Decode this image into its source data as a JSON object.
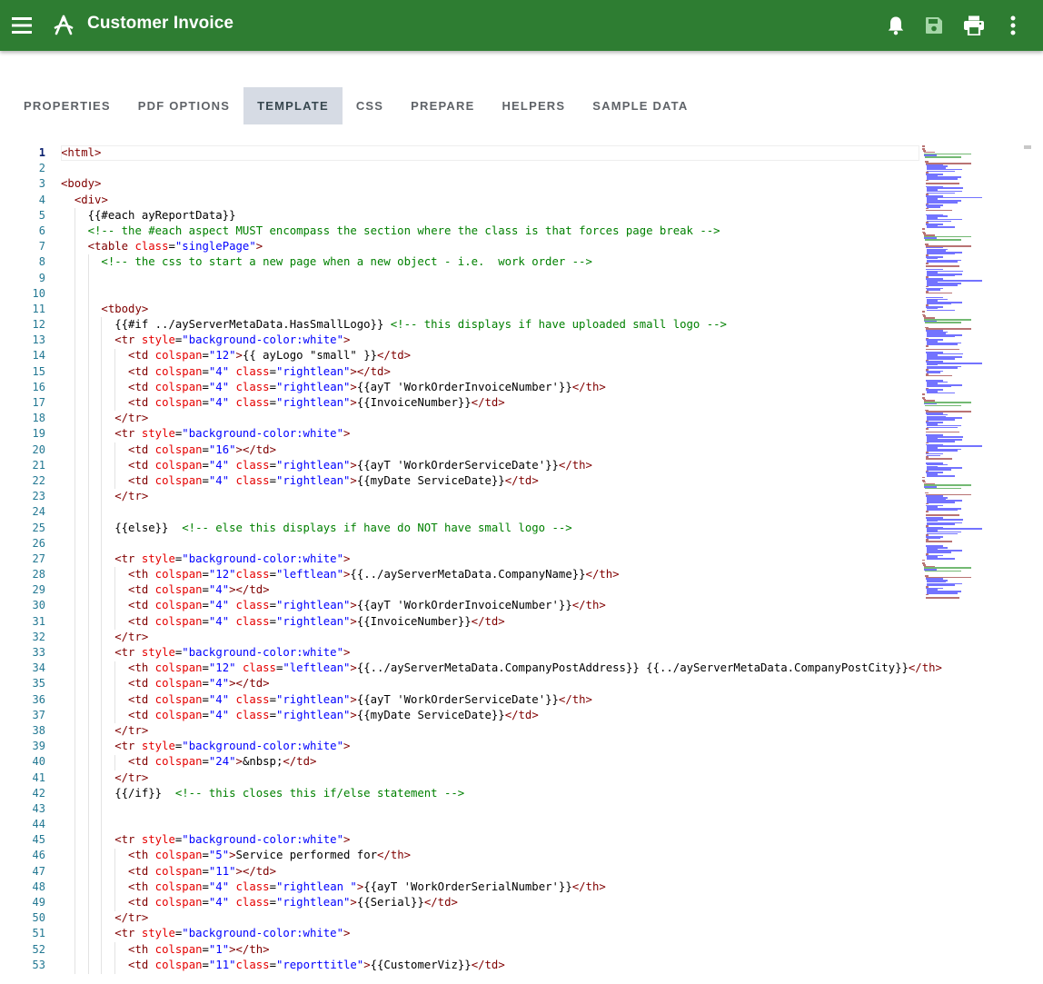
{
  "appbar": {
    "title": "Customer Invoice",
    "icons": [
      "menu-icon",
      "report-designer-icon",
      "bell-icon",
      "save-icon",
      "print-icon",
      "more-vert-icon"
    ],
    "color": "#2e7d32"
  },
  "tabs": [
    {
      "label": "PROPERTIES",
      "active": false
    },
    {
      "label": "PDF OPTIONS",
      "active": false
    },
    {
      "label": "TEMPLATE",
      "active": true
    },
    {
      "label": "CSS",
      "active": false
    },
    {
      "label": "PREPARE",
      "active": false
    },
    {
      "label": "HELPERS",
      "active": false
    },
    {
      "label": "SAMPLE DATA",
      "active": false
    }
  ],
  "editor": {
    "current_line": 1,
    "lines": [
      "<html>",
      "",
      "<body>",
      "  <div>",
      "    {{#each ayReportData}}",
      "    <!-- the #each aspect MUST encompass the section where the class is that forces page break -->",
      "    <table class=\"singlePage\">",
      "      <!-- the css to start a new page when a new object - i.e.  work order -->",
      "",
      "",
      "      <tbody>",
      "        {{#if ../ayServerMetaData.HasSmallLogo}} <!-- this displays if have uploaded small logo -->",
      "        <tr style=\"background-color:white\">",
      "          <td colspan=\"12\">{{ ayLogo \"small\" }}</td>",
      "          <td colspan=\"4\" class=\"rightlean\"></td>",
      "          <td colspan=\"4\" class=\"rightlean\">{{ayT 'WorkOrderInvoiceNumber'}}</th>",
      "          <td colspan=\"4\" class=\"rightlean\">{{InvoiceNumber}}</td>",
      "        </tr>",
      "        <tr style=\"background-color:white\">",
      "          <td colspan=\"16\"></td>",
      "          <td colspan=\"4\" class=\"rightlean\">{{ayT 'WorkOrderServiceDate'}}</th>",
      "          <td colspan=\"4\" class=\"rightlean\">{{myDate ServiceDate}}</td>",
      "        </tr>",
      "",
      "        {{else}}  <!-- else this displays if have do NOT have small logo -->",
      "",
      "        <tr style=\"background-color:white\">",
      "          <th colspan=\"12\"class=\"leftlean\">{{../ayServerMetaData.CompanyName}}</th>",
      "          <td colspan=\"4\"></td>",
      "          <td colspan=\"4\" class=\"rightlean\">{{ayT 'WorkOrderInvoiceNumber'}}</th>",
      "          <td colspan=\"4\" class=\"rightlean\">{{InvoiceNumber}}</td>",
      "        </tr>",
      "        <tr style=\"background-color:white\">",
      "          <th colspan=\"12\" class=\"leftlean\">{{../ayServerMetaData.CompanyPostAddress}} {{../ayServerMetaData.CompanyPostCity}}</th>",
      "          <td colspan=\"4\"></td>",
      "          <td colspan=\"4\" class=\"rightlean\">{{ayT 'WorkOrderServiceDate'}}</th>",
      "          <td colspan=\"4\" class=\"rightlean\">{{myDate ServiceDate}}</td>",
      "        </tr>",
      "        <tr style=\"background-color:white\">",
      "          <td colspan=\"24\">&nbsp;</td>",
      "        </tr>",
      "        {{/if}}  <!-- this closes this if/else statement -->",
      "",
      "",
      "        <tr style=\"background-color:white\">",
      "          <th colspan=\"5\">Service performed for</th>",
      "          <td colspan=\"11\"></td>",
      "          <th colspan=\"4\" class=\"rightlean \">{{ayT 'WorkOrderSerialNumber'}}</th>",
      "          <td colspan=\"4\" class=\"rightlean\">{{Serial}}</td>",
      "        </tr>",
      "        <tr style=\"background-color:white\">",
      "          <th colspan=\"1\"></th>",
      "          <td colspan=\"11\"class=\"reporttitle\">{{CustomerViz}}</td>"
    ]
  },
  "syntax_colors": {
    "tag": "#800000",
    "attribute": "#e50000",
    "string": "#0000ff",
    "comment": "#008000",
    "line_number": "#237893"
  }
}
